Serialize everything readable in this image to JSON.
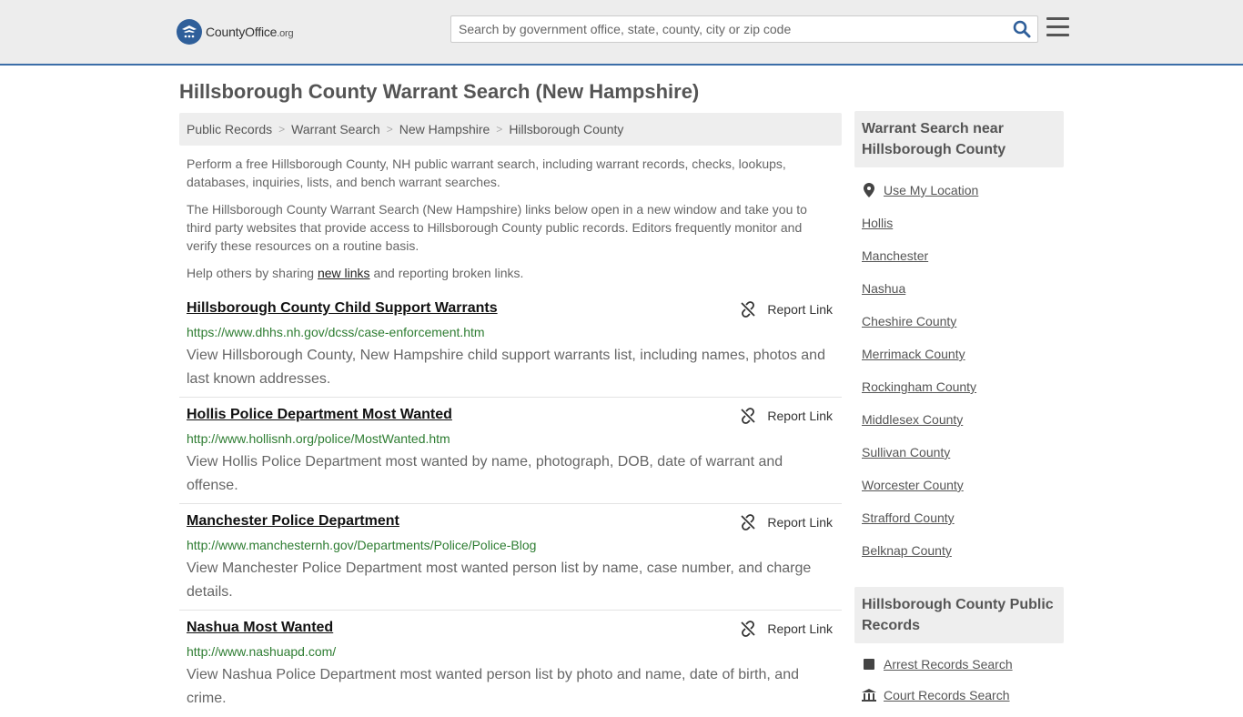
{
  "header": {
    "logo": {
      "name": "CountyOffice",
      "suffix": ".org"
    },
    "search": {
      "placeholder": "Search by government office, state, county, city or zip code"
    }
  },
  "page": {
    "title": "Hillsborough County Warrant Search (New Hampshire)"
  },
  "breadcrumb": [
    "Public Records",
    "Warrant Search",
    "New Hampshire",
    "Hillsborough County"
  ],
  "intro": {
    "p1": "Perform a free Hillsborough County, NH public warrant search, including warrant records, checks, lookups, databases, inquiries, lists, and bench warrant searches.",
    "p2": "The Hillsborough County Warrant Search (New Hampshire) links below open in a new window and take you to third party websites that provide access to Hillsborough County public records. Editors frequently monitor and verify these resources on a routine basis.",
    "p3_before": "Help others by sharing ",
    "p3_link": "new links",
    "p3_after": " and reporting broken links."
  },
  "report_label": "Report Link",
  "listings": [
    {
      "title": "Hillsborough County Child Support Warrants",
      "url": "https://www.dhhs.nh.gov/dcss/case-enforcement.htm",
      "desc": "View Hillsborough County, New Hampshire child support warrants list, including names, photos and last known addresses."
    },
    {
      "title": "Hollis Police Department Most Wanted",
      "url": "http://www.hollisnh.org/police/MostWanted.htm",
      "desc": "View Hollis Police Department most wanted by name, photograph, DOB, date of warrant and offense."
    },
    {
      "title": "Manchester Police Department",
      "url": "http://www.manchesternh.gov/Departments/Police/Police-Blog",
      "desc": "View Manchester Police Department most wanted person list by name, case number, and charge details."
    },
    {
      "title": "Nashua Most Wanted",
      "url": "http://www.nashuapd.com/",
      "desc": "View Nashua Police Department most wanted person list by photo and name, date of birth, and crime."
    }
  ],
  "sidebar": {
    "nearby_heading": "Warrant Search near Hillsborough County",
    "use_location": "Use My Location",
    "nearby": [
      "Hollis",
      "Manchester",
      "Nashua",
      "Cheshire County",
      "Merrimack County",
      "Rockingham County",
      "Middlesex County",
      "Sullivan County",
      "Worcester County",
      "Strafford County",
      "Belknap County"
    ],
    "records_heading": "Hillsborough County Public Records",
    "records": [
      "Arrest Records Search",
      "Court Records Search"
    ]
  },
  "colors": {
    "accent": "#3b6ea8",
    "url_green": "#2e7d32",
    "panel_gray": "#eeeeee"
  }
}
